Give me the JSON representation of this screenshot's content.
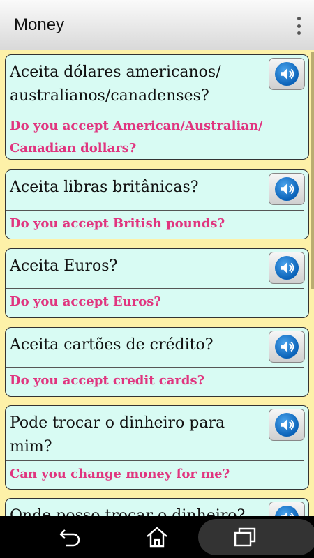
{
  "app_bar": {
    "title": "Money",
    "menu_icon": "more-vert-icon"
  },
  "phrases": [
    {
      "pt": "Aceita dólares americanos/ australianos/canadenses?",
      "en": "Do you accept American/Australian/ Canadian dollars?"
    },
    {
      "pt": "Aceita libras britânicas?",
      "en": "Do you accept British pounds?"
    },
    {
      "pt": "Aceita Euros?",
      "en": "Do you accept Euros?"
    },
    {
      "pt": "Aceita cartões de crédito?",
      "en": "Do you accept credit cards?"
    },
    {
      "pt": "Pode trocar o dinheiro para mim?",
      "en": "Can you change money for me?"
    },
    {
      "pt": "Onde posso trocar o dinheiro?",
      "en": ""
    }
  ],
  "colors": {
    "background": "#fdf1a8",
    "card": "#d8fbf3",
    "translation_text": "#e0357f",
    "speaker_blue": "#0a62b8"
  },
  "icons": {
    "speaker": "speaker-icon",
    "back": "back-icon",
    "home": "home-icon",
    "recents": "recents-icon"
  }
}
